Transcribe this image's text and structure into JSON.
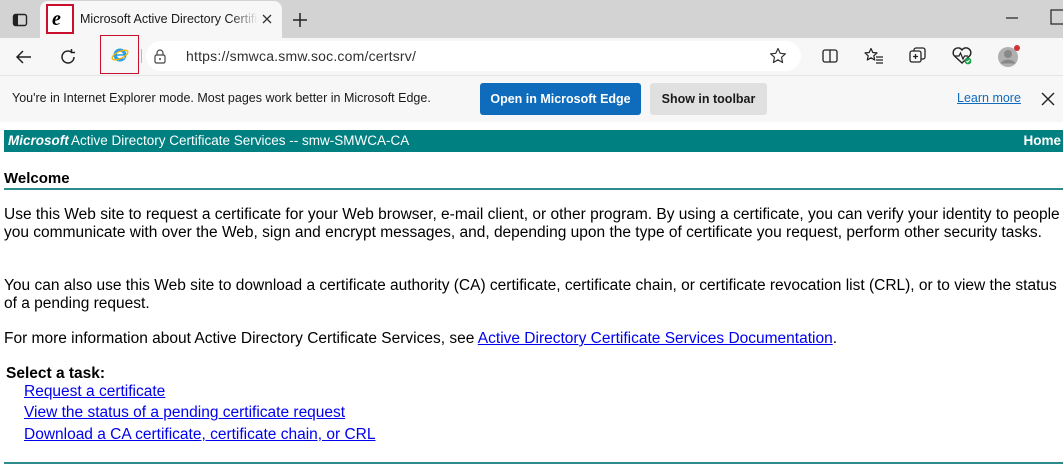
{
  "browser": {
    "tab": {
      "title": "Microsoft Active Directory Certificate Services",
      "favicon": "ie-e-icon"
    },
    "url": "https://smwca.smw.soc.com/certsrv/",
    "icons": [
      "tab-actions-icon",
      "ie-e-icon",
      "close-icon",
      "plus-icon",
      "minimize-icon",
      "maximize-icon",
      "back-arrow-icon",
      "refresh-icon",
      "ie-mode-icon",
      "lock-icon",
      "star-icon",
      "split-screen-icon",
      "favorites-icon",
      "collections-icon",
      "browser-essentials-icon",
      "profile-avatar-icon"
    ]
  },
  "infobar": {
    "message": "You're in Internet Explorer mode. Most pages work better in Microsoft Edge.",
    "open_edge": "Open in Microsoft Edge",
    "show_toolbar": "Show in toolbar",
    "learn_more": "Learn more"
  },
  "page": {
    "header": {
      "brand": "Microsoft",
      "service": "Active Directory Certificate Services  --  smw-SMWCA-CA",
      "home": "Home"
    },
    "welcome": "Welcome",
    "para1": "Use this Web site to request a certificate for your Web browser, e-mail client, or other program. By using a certificate, you can verify your identity to people you communicate with over the Web, sign and encrypt messages, and, depending upon the type of certificate you request, perform other security tasks.",
    "para2": "You can also use this Web site to download a certificate authority (CA) certificate, certificate chain, or certificate revocation list (CRL), or to view the status of a pending request.",
    "para3_prefix": "For more information about Active Directory Certificate Services, see ",
    "para3_link": "Active Directory Certificate Services Documentation",
    "para3_suffix": ".",
    "select_task": "Select a task:",
    "tasks": [
      "Request a certificate",
      "View the status of a pending certificate request",
      "Download a CA certificate, certificate chain, or CRL"
    ]
  },
  "colors": {
    "header_teal": "#008080",
    "link_blue": "#0000ee",
    "edge_blue": "#0f6cbd",
    "highlight_red": "#c8102e"
  }
}
